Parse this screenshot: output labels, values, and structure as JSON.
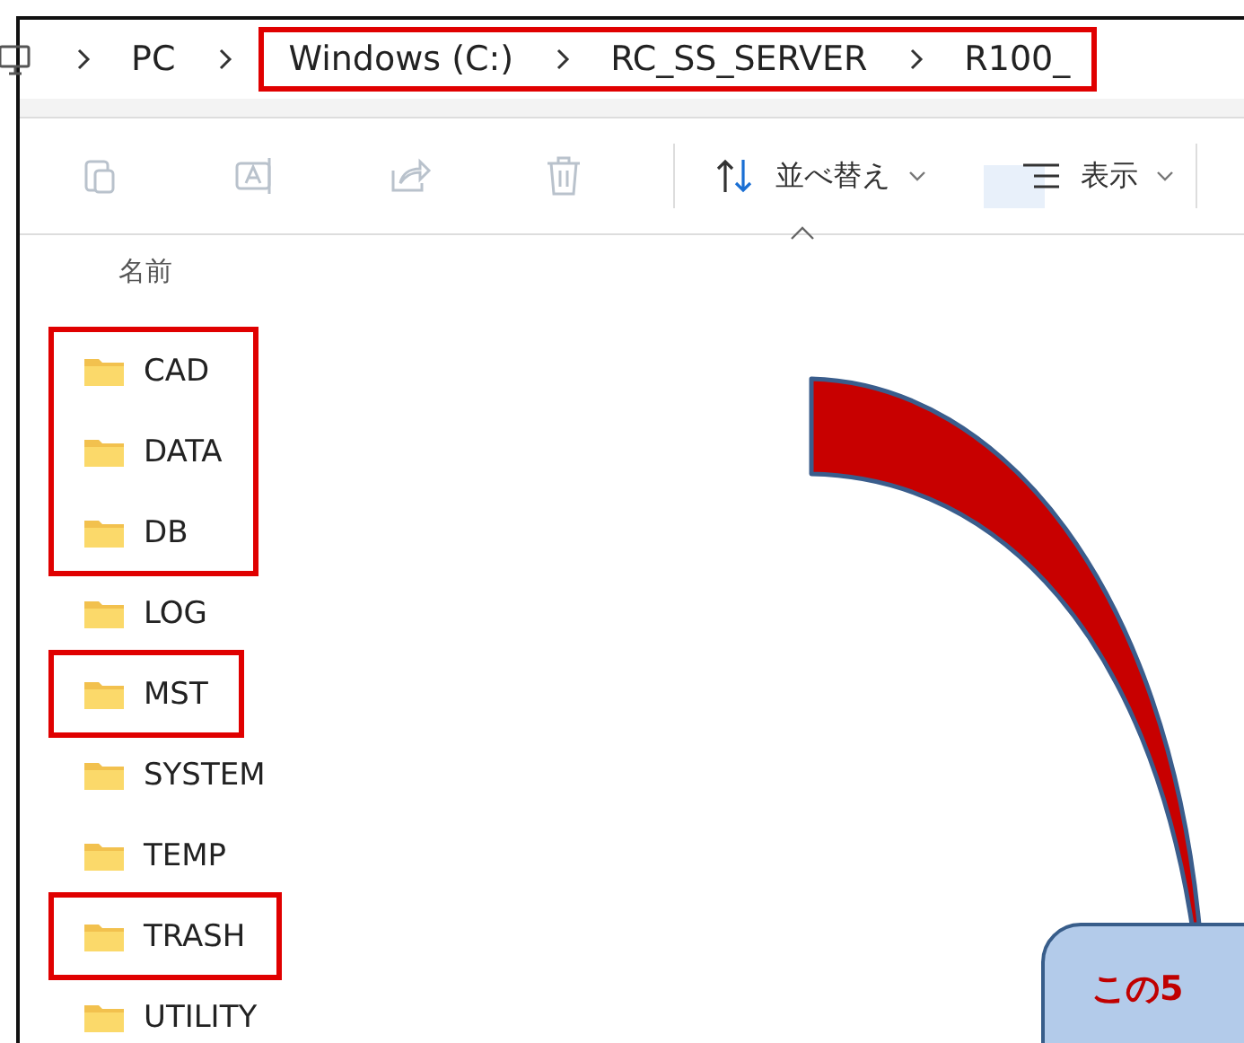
{
  "breadcrumb": [
    {
      "highlighted": false,
      "items": [
        "PC"
      ]
    },
    {
      "highlighted": true,
      "items": [
        "Windows (C:)",
        "RC_SS_SERVER",
        "R100_"
      ]
    }
  ],
  "toolbar": {
    "actions": [
      {
        "kind": "copy",
        "disabled": true
      },
      {
        "kind": "rename",
        "disabled": true
      },
      {
        "kind": "share",
        "disabled": true
      },
      {
        "kind": "delete",
        "disabled": true
      }
    ],
    "sort": {
      "label": "並べ替え"
    },
    "view": {
      "label": "表示"
    }
  },
  "column": {
    "label": "名前"
  },
  "folder_groups": [
    {
      "highlighted": true,
      "folders": [
        "CAD",
        "DATA",
        "DB"
      ]
    },
    {
      "highlighted": false,
      "folders": [
        "LOG"
      ]
    },
    {
      "highlighted": true,
      "folders": [
        "MST"
      ]
    },
    {
      "highlighted": false,
      "folders": [
        "SYSTEM",
        "TEMP"
      ]
    },
    {
      "highlighted": true,
      "folders": [
        "TRASH"
      ]
    },
    {
      "highlighted": false,
      "folders": [
        "UTILITY"
      ]
    }
  ],
  "callout": {
    "text": "この5"
  }
}
